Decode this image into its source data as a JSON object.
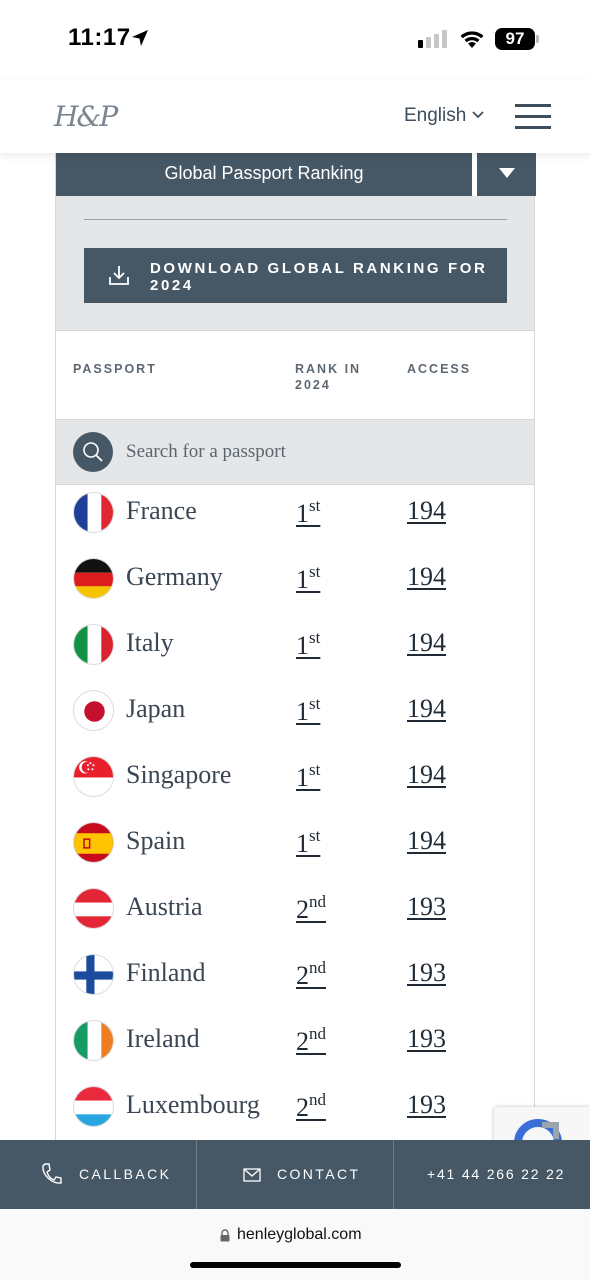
{
  "status_bar": {
    "time": "11:17",
    "battery": "97"
  },
  "header": {
    "logo": "H&P",
    "language": "English"
  },
  "ranking": {
    "selector_label": "Global Passport Ranking",
    "download_label": "DOWNLOAD GLOBAL RANKING FOR 2024",
    "columns": {
      "passport": "PASSPORT",
      "rank": "RANK IN 2024",
      "access": "ACCESS"
    },
    "search_placeholder": "Search for a passport",
    "rows": [
      {
        "country": "France",
        "rank": "1",
        "suffix": "st",
        "access": "194",
        "flag": "flag-france"
      },
      {
        "country": "Germany",
        "rank": "1",
        "suffix": "st",
        "access": "194",
        "flag": "flag-germany"
      },
      {
        "country": "Italy",
        "rank": "1",
        "suffix": "st",
        "access": "194",
        "flag": "flag-italy"
      },
      {
        "country": "Japan",
        "rank": "1",
        "suffix": "st",
        "access": "194",
        "flag": "flag-japan"
      },
      {
        "country": "Singapore",
        "rank": "1",
        "suffix": "st",
        "access": "194",
        "flag": "flag-singapore"
      },
      {
        "country": "Spain",
        "rank": "1",
        "suffix": "st",
        "access": "194",
        "flag": "flag-spain"
      },
      {
        "country": "Austria",
        "rank": "2",
        "suffix": "nd",
        "access": "193",
        "flag": "flag-austria"
      },
      {
        "country": "Finland",
        "rank": "2",
        "suffix": "nd",
        "access": "193",
        "flag": "flag-finland"
      },
      {
        "country": "Ireland",
        "rank": "2",
        "suffix": "nd",
        "access": "193",
        "flag": "flag-ireland"
      },
      {
        "country": "Luxembourg",
        "rank": "2",
        "suffix": "nd",
        "access": "193",
        "flag": "flag-luxembourg"
      }
    ]
  },
  "contact_bar": {
    "callback": "CALLBACK",
    "contact": "CONTACT",
    "phone": "+41 44 266 22 22"
  },
  "browser": {
    "url": "henleyglobal.com"
  },
  "colors": {
    "primary": "#465766",
    "panel_grey": "#e5e6e7",
    "text": "#3a4653"
  }
}
